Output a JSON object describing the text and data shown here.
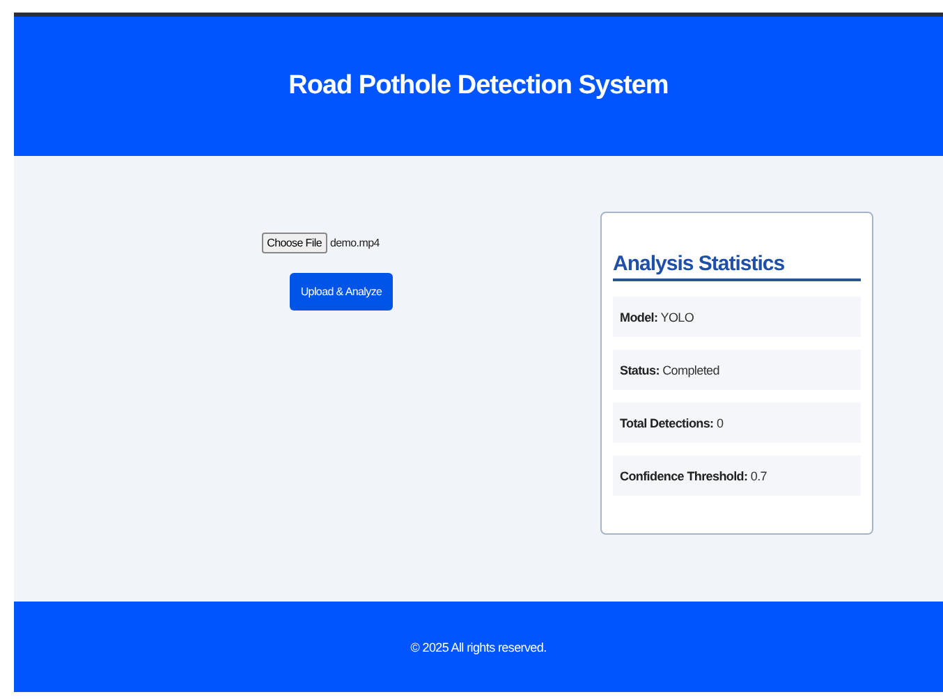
{
  "header": {
    "title": "Road Pothole Detection System"
  },
  "upload": {
    "choose_button": "Choose File",
    "file_name": "demo.mp4",
    "submit_button": "Upload & Analyze"
  },
  "stats": {
    "title": "Analysis Statistics",
    "items": [
      {
        "label": "Model:",
        "value": "YOLO"
      },
      {
        "label": "Status:",
        "value": "Completed"
      },
      {
        "label": "Total Detections:",
        "value": "0"
      },
      {
        "label": "Confidence Threshold:",
        "value": "0.7"
      }
    ]
  },
  "footer": {
    "text": "© 2025 All rights reserved."
  }
}
